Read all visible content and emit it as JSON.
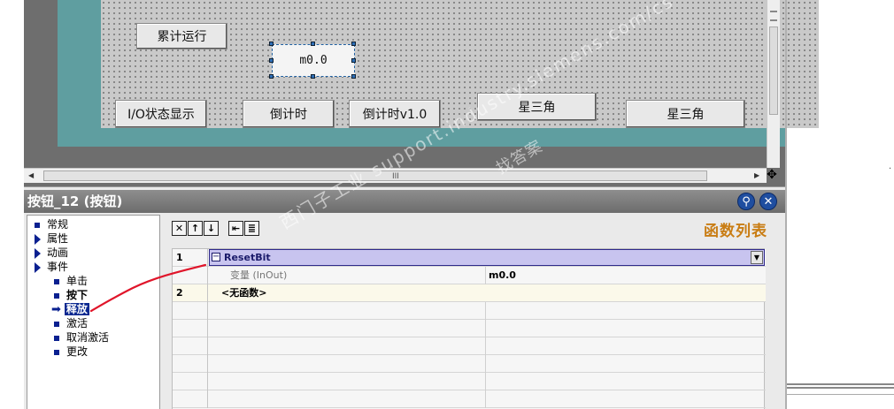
{
  "canvas": {
    "buttons": [
      {
        "label": "累计运行"
      },
      {
        "label": "m0.0"
      },
      {
        "label": "I/O状态显示"
      },
      {
        "label": "倒计时"
      },
      {
        "label": "倒计时v1.0"
      },
      {
        "label": "星三角"
      },
      {
        "label": "星三角"
      }
    ],
    "hscroll_grip": "III"
  },
  "properties": {
    "title": "按钮_12 (按钮)",
    "pin_icon": "pin-icon",
    "close_icon": "close-icon",
    "tree": [
      {
        "label": "常规",
        "marker": "bullet"
      },
      {
        "label": "属性",
        "marker": "triangle"
      },
      {
        "label": "动画",
        "marker": "triangle"
      },
      {
        "label": "事件",
        "marker": "triangle"
      },
      {
        "label": "单击",
        "marker": "bullet"
      },
      {
        "label": "按下",
        "marker": "bullet"
      },
      {
        "label": "释放",
        "marker": "arrow",
        "selected": true
      },
      {
        "label": "激活",
        "marker": "bullet"
      },
      {
        "label": "取消激活",
        "marker": "bullet"
      },
      {
        "label": "更改",
        "marker": "bullet"
      }
    ],
    "toolbar": [
      "delete-icon",
      "move-up-icon",
      "move-down-icon",
      "outdent-icon",
      "indent-icon"
    ],
    "panel_title": "函数列表",
    "grid": {
      "rows": [
        {
          "num": "1",
          "function": "ResetBit"
        },
        {
          "param_name": "变量 (InOut)",
          "param_value": "m0.0"
        },
        {
          "num": "2",
          "function": "<无函数>"
        }
      ]
    }
  },
  "watermark": {
    "text1": "西门子工业 support.industry.siemens.com/cs",
    "text2": "找答案"
  },
  "colors": {
    "canvas_frame": "#5f9ea0",
    "panel_title": "#c97d14",
    "selection": "#0a2890",
    "row_highlight": "#c8c4ef"
  }
}
